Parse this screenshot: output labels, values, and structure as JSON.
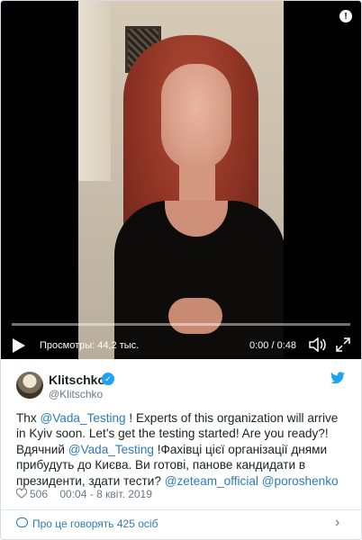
{
  "video": {
    "views_text": "Просмотры: 44,2 тыс.",
    "time_text": "0:00 / 0:48",
    "progress": 0.0,
    "gif_label": "!"
  },
  "tweet": {
    "author_name": "Klitschko",
    "author_handle": "@Klitschko",
    "text_parts": [
      {
        "t": "Thx "
      },
      {
        "t": "@Vada_Testing",
        "link": true
      },
      {
        "t": " ! Experts of this organization will arrive in Kyiv soon. Let’s get the testing started! Are you ready?! Вдячний "
      },
      {
        "t": "@Vada_Testing",
        "link": true
      },
      {
        "t": " !Фахівці цієї організації днями прибудуть до Києва. Ви готові, панове кандидати в президенти, здати тести? "
      },
      {
        "t": "@zeteam_official",
        "link": true
      },
      {
        "t": " "
      },
      {
        "t": "@poroshenko",
        "link": true
      }
    ],
    "likes": "506",
    "timestamp": "00:04 - 8 квіт. 2019"
  },
  "conversation": {
    "label": "Про це говорять 425 осіб"
  },
  "colors": {
    "link": "#2b7bb9",
    "verified": "#1da1f2",
    "muted": "#697882"
  },
  "icons": [
    "play-icon",
    "volume-icon",
    "fullscreen-icon",
    "twitter-bird-icon",
    "verified-icon",
    "heart-icon",
    "comment-bubble-icon",
    "chevron-right-icon"
  ]
}
